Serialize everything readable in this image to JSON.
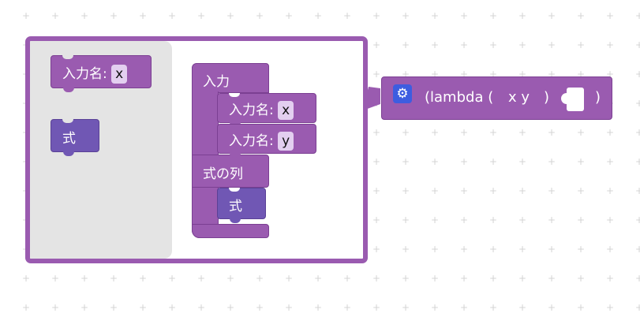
{
  "colors": {
    "block": "#9a5bb0",
    "expression_block": "#7057b4",
    "field_bg": "#e3cff0",
    "mutator_icon": "#3d5de0",
    "workspace_bg": "#ffffff",
    "flyout_bg": "#e4e4e4"
  },
  "mutator": {
    "flyout": {
      "input_name_block": {
        "label": "入力名:",
        "value": "x"
      },
      "expression_block": {
        "label": "式"
      }
    },
    "container": {
      "inputs_label": "入力",
      "input_items": [
        {
          "label": "入力名:",
          "value": "x"
        },
        {
          "label": "入力名:",
          "value": "y"
        }
      ],
      "expression_sequence_label": "式の列",
      "expression_item": {
        "label": "式"
      }
    }
  },
  "lambda_block": {
    "icon": "gear-icon",
    "text_open": "(lambda (",
    "params": "x y",
    "text_close_params": ")",
    "text_close": ")"
  }
}
